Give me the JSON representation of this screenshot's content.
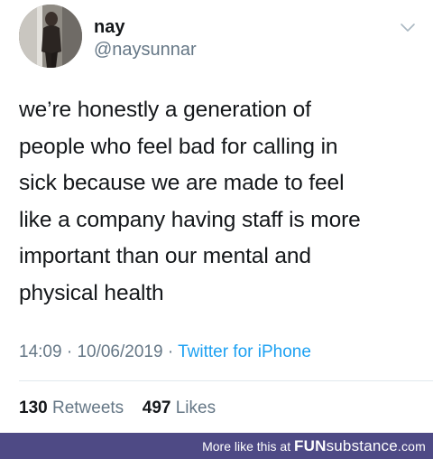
{
  "tweet": {
    "display_name": "nay",
    "handle": "@naysunnar",
    "text": "we’re honestly a generation of\npeople who feel bad for calling in\nsick because we are made to feel\nlike a company having staff is more\nimportant than our mental and\nphysical health",
    "time": "14:09",
    "separator": "·",
    "date": "10/06/2019",
    "source": "Twitter for iPhone",
    "retweets_count": "130",
    "retweets_label": "Retweets",
    "likes_count": "497",
    "likes_label": "Likes"
  },
  "icons": {
    "menu": "chevron-down-icon"
  },
  "colors": {
    "text": "#14171a",
    "secondary": "#657786",
    "link": "#1da1f2",
    "footer_bg": "#4e4a85"
  },
  "footer": {
    "prefix": "More like this at",
    "brand_part1": "FUN",
    "brand_part2": "substance",
    "brand_tld": ".com"
  }
}
